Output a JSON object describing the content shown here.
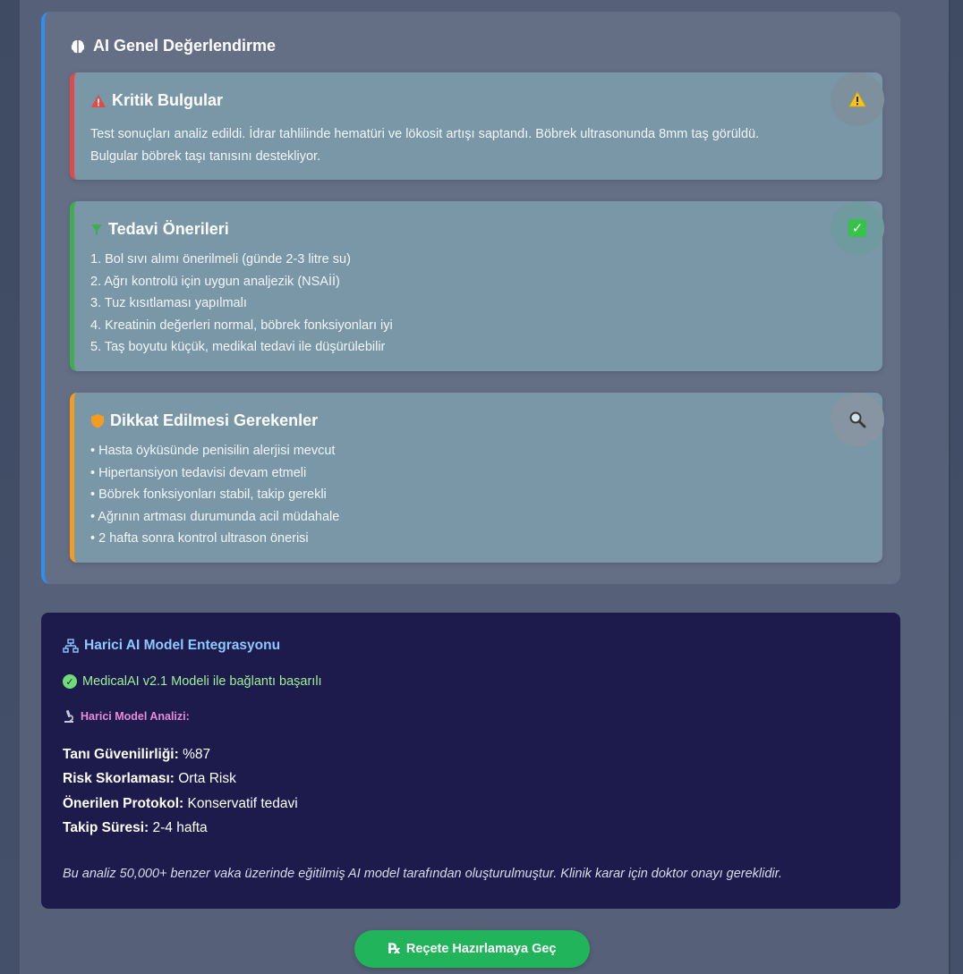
{
  "ai_overview": {
    "title": "AI Genel Değerlendirme",
    "cards": {
      "critical": {
        "title": "Kritik Bulgular",
        "icon": "warning-icon",
        "accent": "#e04a4a",
        "lines": [
          "Test sonuçları analiz edildi. İdrar tahlilinde hematüri ve lökosit artışı saptandı. Böbrek ultrasonunda 8mm taş görüldü.",
          "Bulgular böbrek taşı tanısını destekliyor."
        ]
      },
      "treatment": {
        "title": "Tedavi Önerileri",
        "icon": "pill-icon",
        "accent": "#3fae4f",
        "lines": [
          "1. Bol sıvı alımı önerilmeli (günde 2-3 litre su)",
          "2. Ağrı kontrolü için uygun analjezik (NSAİİ)",
          "3. Tuz kısıtlaması yapılmalı",
          "4. Kreatinin değerleri normal, böbrek fonksiyonları iyi",
          "5. Taş boyutu küçük, medikal tedavi ile düşürülebilir"
        ]
      },
      "attention": {
        "title": "Dikkat Edilmesi Gerekenler",
        "icon": "shield-icon",
        "accent": "#f39c1f",
        "lines": [
          "• Hasta öyküsünde penisilin alerjisi mevcut",
          "• Hipertansiyon tedavisi devam etmeli",
          "• Böbrek fonksiyonları stabil, takip gerekli",
          "• Ağrının artması durumunda acil müdahale",
          "• 2 hafta sonra kontrol ultrason önerisi"
        ]
      }
    }
  },
  "external_model": {
    "title": "Harici AI Model Entegrasyonu",
    "status": "MedicalAI v2.1 Modeli ile bağlantı başarılı",
    "analysis_label": "Harici Model Analizi:",
    "metrics": [
      {
        "label": "Tanı Güvenilirliği:",
        "value": "%87"
      },
      {
        "label": "Risk Skorlaması:",
        "value": "Orta Risk"
      },
      {
        "label": "Önerilen Protokol:",
        "value": "Konservatif tedavi"
      },
      {
        "label": "Takip Süresi:",
        "value": "2-4 hafta"
      }
    ],
    "note": "Bu analiz 50,000+ benzer vaka üzerinde eğitilmiş AI model tarafından oluşturulmuştur. Klinik karar için doktor onayı gereklidir."
  },
  "actions": {
    "prescription_button": "Reçete Hazırlamaya Geç",
    "prescription_icon": "℞"
  },
  "colors": {
    "brand_green": "#21b45a",
    "overview_border": "#2f8ff0",
    "ext_background": "#1c1b4b"
  }
}
